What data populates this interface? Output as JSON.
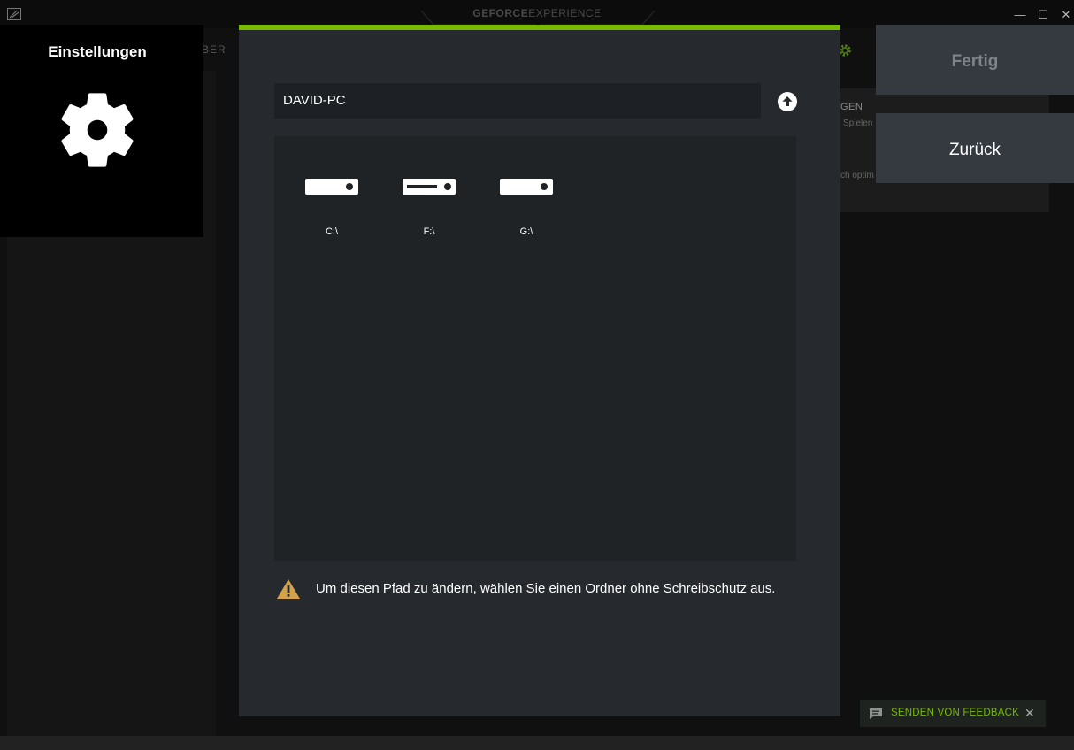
{
  "window": {
    "title_bold": "GEFORCE",
    "title_light": "EXPERIENCE",
    "minimize": "—",
    "maximize": "☐",
    "close": "✕"
  },
  "background": {
    "nav_fragment": "BER",
    "card_title": "GEN",
    "card_sub": "Spielen",
    "card_sub2": "ch optim"
  },
  "settings": {
    "title": "Einstellungen",
    "icon": "gear-icon"
  },
  "dialog": {
    "accent_color": "#76b900",
    "path": "DAVID-PC",
    "up_icon": "arrow-up-circle-icon",
    "drives": [
      {
        "label": "C:\\",
        "icon": "hard-drive-icon"
      },
      {
        "label": "F:\\",
        "icon": "optical-drive-icon"
      },
      {
        "label": "G:\\",
        "icon": "hard-drive-icon"
      }
    ],
    "warning_icon": "warning-triangle-icon",
    "warning_text": "Um diesen Pfad zu ändern, wählen Sie einen Ordner ohne Schreibschutz aus."
  },
  "actions": {
    "done": "Fertig",
    "back": "Zurück"
  },
  "feedback": {
    "label": "SENDEN VON FEEDBACK",
    "close": "✕",
    "icon": "comment-icon"
  }
}
